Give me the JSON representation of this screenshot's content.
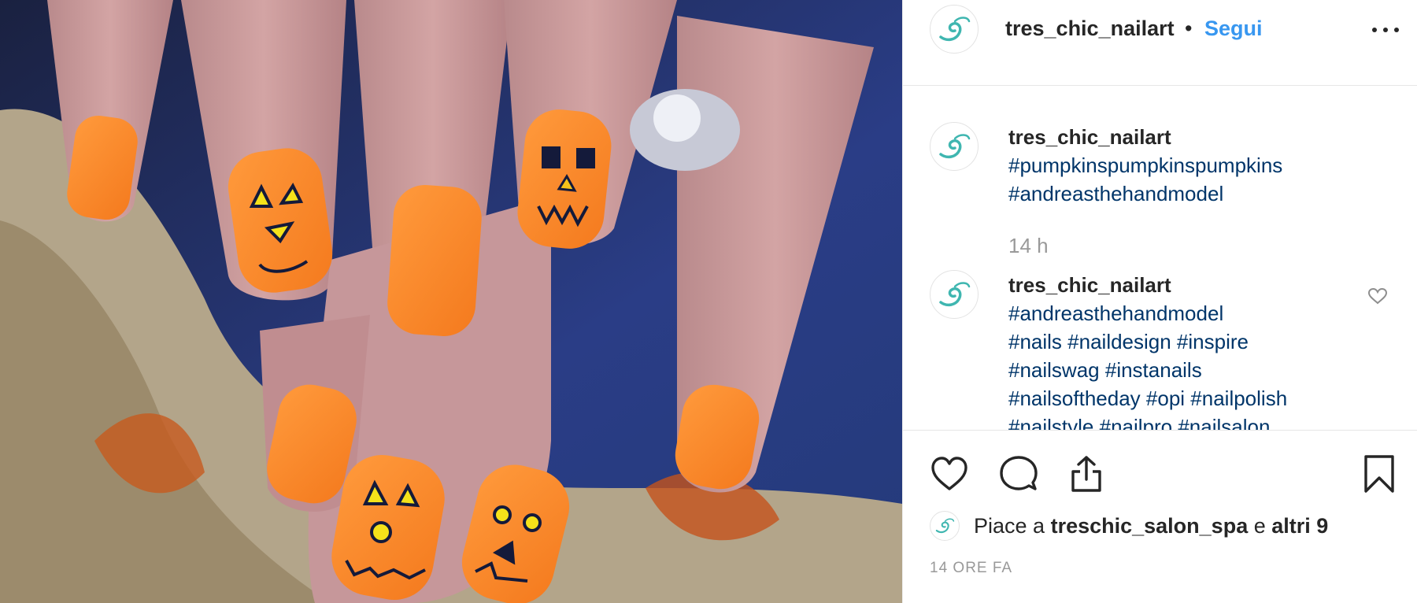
{
  "post": {
    "username": "tres_chic_nailart",
    "separator": "•",
    "follow_label": "Segui"
  },
  "caption": {
    "username": "tres_chic_nailart",
    "lines": [
      "#pumpkinspumpkinspumpkins",
      "#andreasthehandmodel"
    ],
    "time": "14 h"
  },
  "comment": {
    "username": "tres_chic_nailart",
    "lines": [
      "#andreasthehandmodel",
      "#nails #naildesign #inspire",
      "#nailswag #instanails",
      "#nailsoftheday #opi #nailpolish",
      "#nailstyle #nailpro #nailsalon"
    ]
  },
  "likes": {
    "prefix": "Piace a",
    "liker": "treschic_salon_spa",
    "joiner": "e",
    "others": "altri 9"
  },
  "timestamp": "14 ORE FA",
  "icons": {
    "logo": "swirl-logo-icon",
    "more": "more-options-icon",
    "like": "heart-icon",
    "comment": "comment-bubble-icon",
    "share": "share-icon",
    "save": "bookmark-icon"
  },
  "colors": {
    "link": "#3897f0",
    "hashtag": "#003569",
    "muted": "#999999",
    "logo": "#3fb6b0",
    "nail_orange": "#ff8a2a"
  }
}
